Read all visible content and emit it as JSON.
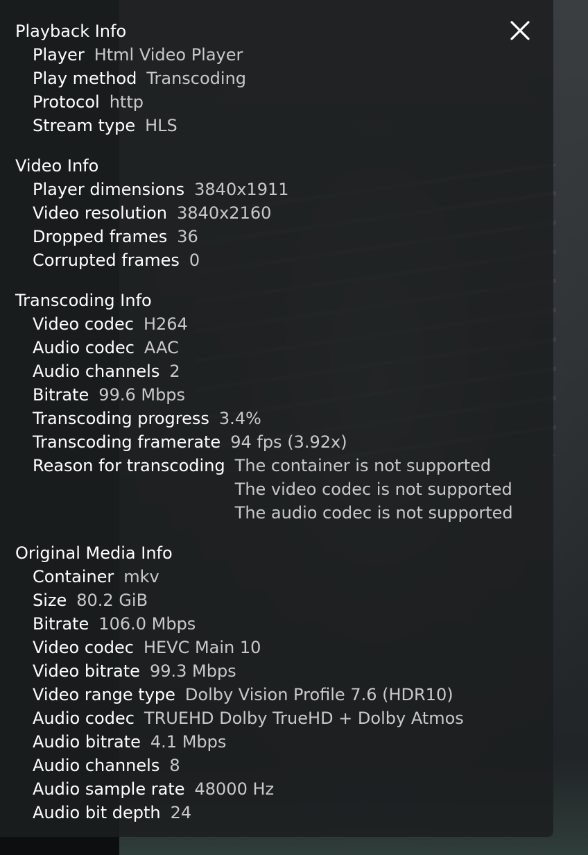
{
  "close_label": "Close",
  "sections": {
    "playback": {
      "title": "Playback Info",
      "rows": [
        {
          "label": "Player",
          "value": "Html Video Player"
        },
        {
          "label": "Play method",
          "value": "Transcoding"
        },
        {
          "label": "Protocol",
          "value": "http"
        },
        {
          "label": "Stream type",
          "value": "HLS"
        }
      ]
    },
    "video": {
      "title": "Video Info",
      "rows": [
        {
          "label": "Player dimensions",
          "value": "3840x1911"
        },
        {
          "label": "Video resolution",
          "value": "3840x2160"
        },
        {
          "label": "Dropped frames",
          "value": "36"
        },
        {
          "label": "Corrupted frames",
          "value": "0"
        }
      ]
    },
    "transcoding": {
      "title": "Transcoding Info",
      "rows": [
        {
          "label": "Video codec",
          "value": "H264"
        },
        {
          "label": "Audio codec",
          "value": "AAC"
        },
        {
          "label": "Audio channels",
          "value": "2"
        },
        {
          "label": "Bitrate",
          "value": "99.6 Mbps"
        },
        {
          "label": "Transcoding progress",
          "value": "3.4%"
        },
        {
          "label": "Transcoding framerate",
          "value": "94 fps (3.92x)"
        }
      ],
      "reason": {
        "label": "Reason for transcoding",
        "values": [
          "The container is not supported",
          "The video codec is not supported",
          "The audio codec is not supported"
        ]
      }
    },
    "original": {
      "title": "Original Media Info",
      "rows": [
        {
          "label": "Container",
          "value": "mkv"
        },
        {
          "label": "Size",
          "value": "80.2 GiB"
        },
        {
          "label": "Bitrate",
          "value": "106.0 Mbps"
        },
        {
          "label": "Video codec",
          "value": "HEVC Main 10"
        },
        {
          "label": "Video bitrate",
          "value": "99.3 Mbps"
        },
        {
          "label": "Video range type",
          "value": "Dolby Vision Profile 7.6 (HDR10)"
        },
        {
          "label": "Audio codec",
          "value": "TRUEHD Dolby TrueHD + Dolby Atmos"
        },
        {
          "label": "Audio bitrate",
          "value": "4.1 Mbps"
        },
        {
          "label": "Audio channels",
          "value": "8"
        },
        {
          "label": "Audio sample rate",
          "value": "48000 Hz"
        },
        {
          "label": "Audio bit depth",
          "value": "24"
        }
      ]
    }
  }
}
